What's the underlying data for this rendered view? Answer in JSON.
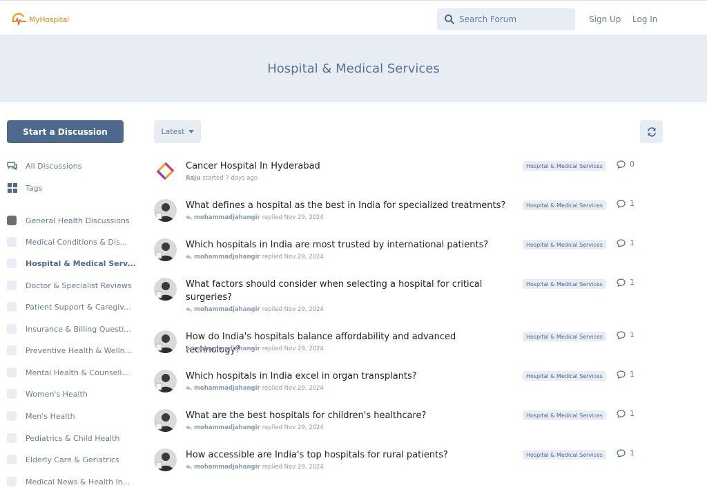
{
  "header": {
    "logo_text": "MyHospital",
    "search_placeholder": "Search Forum",
    "signup": "Sign Up",
    "login": "Log In"
  },
  "hero": {
    "title": "Hospital & Medical Services"
  },
  "sidebar": {
    "start_button": "Start a Discussion",
    "all_discussions": "All Discussions",
    "tags": "Tags",
    "tag_items": [
      "General Health Discussions",
      "Medical Conditions & Dis...",
      "Hospital & Medical Serv...",
      "Doctor & Specialist Reviews",
      "Patient Support & Caregiv...",
      "Insurance & Billing Questi...",
      "Preventive Health & Welln...",
      "Mental Health & Counseli...",
      "Women's Health",
      "Men's Health",
      "Pediatrics & Child Health",
      "Elderly Care & Geriatrics",
      "Medical News & Health In..."
    ]
  },
  "toolbar": {
    "sort": "Latest"
  },
  "discussions": [
    {
      "title": "Cancer Hospital In Hyderabad",
      "user": "Raju",
      "action": "started 7 days ago",
      "tag": "Hospital & Medical Services",
      "replies": "0"
    },
    {
      "title": "What defines a hospital as the best in India for specialized treatments?",
      "user": "mohammadjahangir",
      "action": "replied Nov 29, 2024",
      "tag": "Hospital & Medical Services",
      "replies": "1"
    },
    {
      "title": "Which hospitals in India are most trusted by international patients?",
      "user": "mohammadjahangir",
      "action": "replied Nov 29, 2024",
      "tag": "Hospital & Medical Services",
      "replies": "1"
    },
    {
      "title": "What factors should consider when selecting a hospital for critical surgeries?",
      "user": "mohammadjahangir",
      "action": "replied Nov 29, 2024",
      "tag": "Hospital & Medical Services",
      "replies": "1"
    },
    {
      "title": "How do India's hospitals balance affordability and advanced technology?",
      "user": "mohammadjahangir",
      "action": "replied Nov 29, 2024",
      "tag": "Hospital & Medical Services",
      "replies": "1"
    },
    {
      "title": "Which hospitals in India excel in organ transplants?",
      "user": "mohammadjahangir",
      "action": "replied Nov 29, 2024",
      "tag": "Hospital & Medical Services",
      "replies": "1"
    },
    {
      "title": "What are the best hospitals for children's healthcare?",
      "user": "mohammadjahangir",
      "action": "replied Nov 29, 2024",
      "tag": "Hospital & Medical Services",
      "replies": "1"
    },
    {
      "title": "How accessible are India's top hospitals for rural patients?",
      "user": "mohammadjahangir",
      "action": "replied Nov 29, 2024",
      "tag": "Hospital & Medical Services",
      "replies": "1"
    }
  ]
}
